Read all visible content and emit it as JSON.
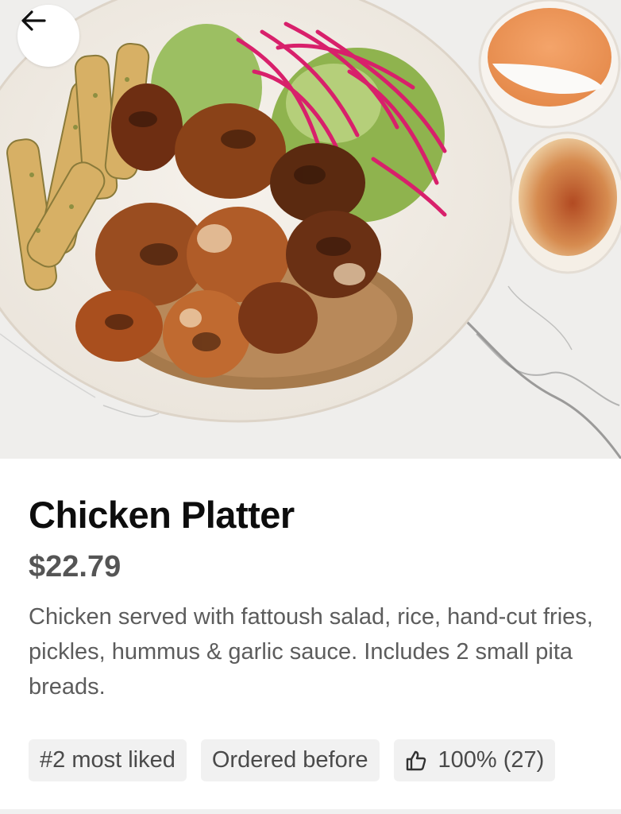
{
  "item": {
    "name": "Chicken Platter",
    "price": "$22.79",
    "description": "Chicken served with fattoush salad, rice, hand-cut fries, pickles, hummus & garlic sauce. Includes 2 small pita breads."
  },
  "badges": [
    {
      "label": "#2 most liked",
      "icon": ""
    },
    {
      "label": "Ordered before",
      "icon": ""
    },
    {
      "label": "100% (27)",
      "icon": "thumbs-up-icon"
    }
  ],
  "hero": {
    "icon": "back-arrow-icon"
  }
}
